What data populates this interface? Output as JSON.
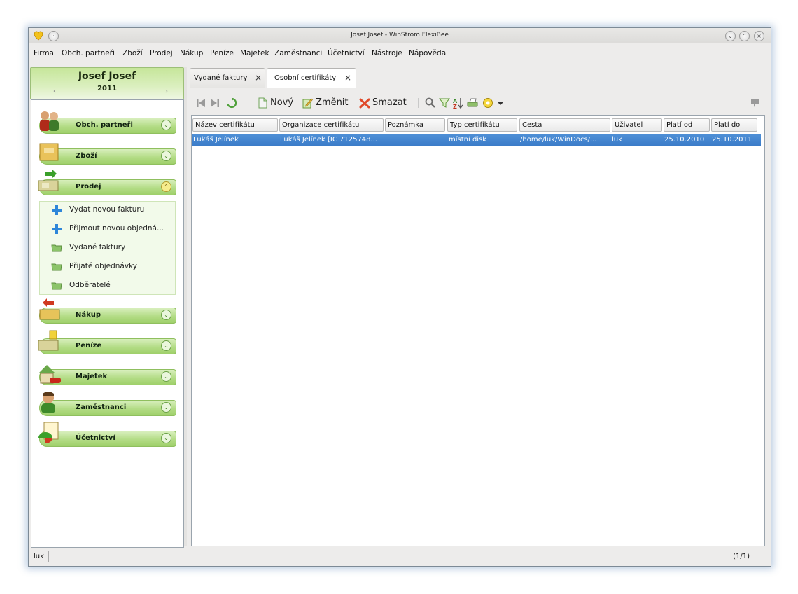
{
  "window": {
    "title": "Josef Josef - WinStrom FlexiBee"
  },
  "menu": [
    "Firma",
    "Obch. partneři",
    "Zboží",
    "Prodej",
    "Nákup",
    "Peníze",
    "Majetek",
    "Zaměstnanci",
    "Účetnictví",
    "Nástroje",
    "Nápověda"
  ],
  "left": {
    "company": "Josef Josef",
    "year": "2011",
    "prev": "‹",
    "next": "›",
    "groups": [
      {
        "label": "Obch. partneři",
        "icon": "partners-icon"
      },
      {
        "label": "Zboží",
        "icon": "goods-icon"
      },
      {
        "label": "Prodej",
        "icon": "sales-icon"
      },
      {
        "label": "Nákup",
        "icon": "purchase-icon"
      },
      {
        "label": "Peníze",
        "icon": "money-icon"
      },
      {
        "label": "Majetek",
        "icon": "property-icon"
      },
      {
        "label": "Zaměstnanci",
        "icon": "employees-icon"
      },
      {
        "label": "Účetnictví",
        "icon": "accounting-icon"
      }
    ],
    "sales_items": [
      "Vydat novou fakturu",
      "Přijmout novou objedná...",
      "Vydané faktury",
      "Přijaté objednávky",
      "Odběratelé"
    ]
  },
  "tabs": [
    {
      "label": "Vydané faktury",
      "close": "×"
    },
    {
      "label": "Osobní certifikáty",
      "close": "×"
    }
  ],
  "toolbar": {
    "new": "Nový",
    "edit": "Změnit",
    "delete": "Smazat"
  },
  "table": {
    "headers": [
      "Název certifikátu",
      "Organizace certifikátu",
      "Poznámka",
      "Typ certifikátu",
      "Cesta",
      "Uživatel",
      "Platí od",
      "Platí do"
    ],
    "rows": [
      [
        "Lukáš Jelínek",
        "Lukáš Jelínek [IČ 7125748...",
        "",
        "místní disk",
        "/home/luk/WinDocs/...",
        "luk",
        "25.10.2010",
        "25.10.2011"
      ]
    ]
  },
  "status": {
    "user": "luk",
    "count": "(1/1)"
  },
  "colors": {
    "selection": "#3a7bc8",
    "group_green": "#b3dc86"
  }
}
